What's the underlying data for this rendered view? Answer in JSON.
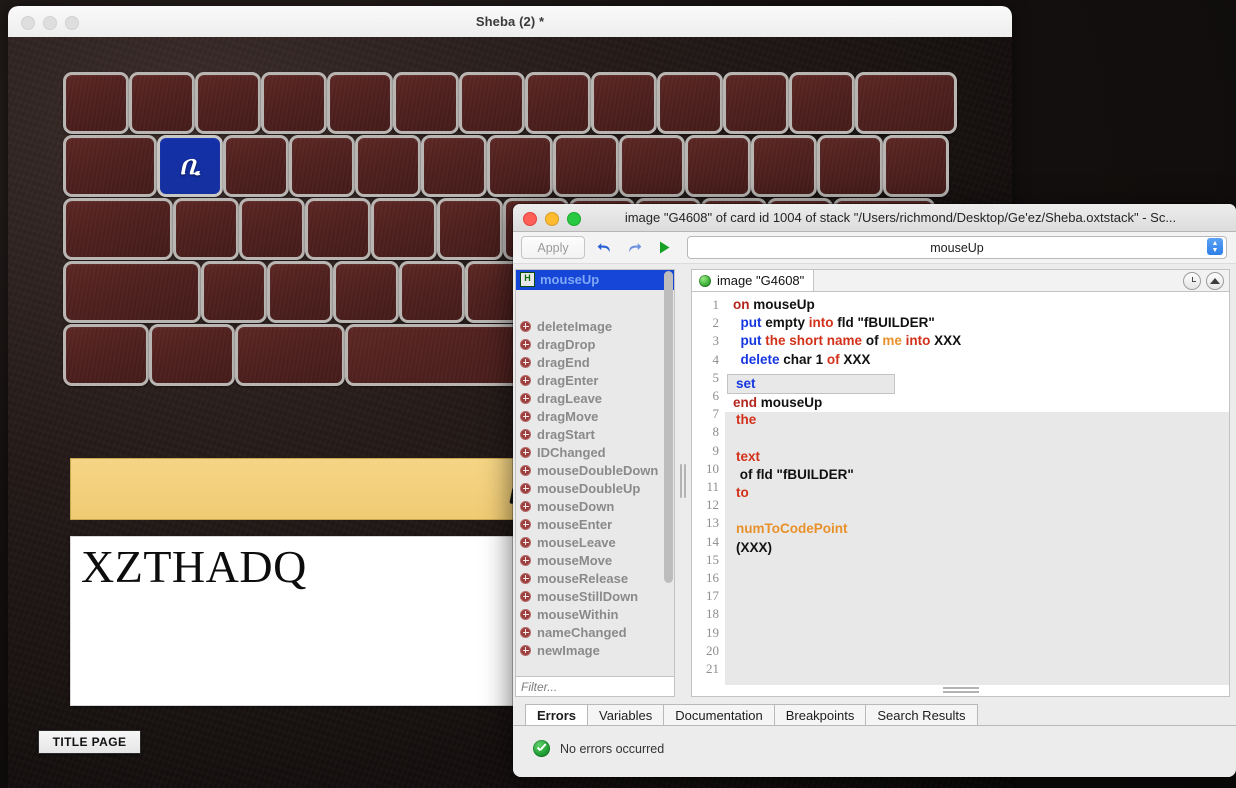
{
  "stack_window": {
    "title": "Sheba (2) *",
    "traffic_lights": [
      "close",
      "minimize",
      "zoom"
    ],
    "keyboard": {
      "selected_key_glyph": "ቢ",
      "rows": [
        {
          "count": 13,
          "widths": [
            60,
            60,
            60,
            60,
            60,
            60,
            60,
            60,
            60,
            60,
            60,
            60,
            96
          ]
        },
        {
          "count": 13,
          "widths": [
            88,
            60,
            60,
            60,
            60,
            60,
            60,
            60,
            60,
            60,
            60,
            60,
            60
          ]
        },
        {
          "count": 12,
          "widths": [
            104,
            60,
            60,
            60,
            60,
            60,
            60,
            60,
            60,
            60,
            60,
            96
          ]
        },
        {
          "count": 11,
          "widths": [
            132,
            60,
            60,
            60,
            60,
            60,
            60,
            60,
            60,
            60,
            112
          ]
        },
        {
          "count": 5,
          "widths": [
            80,
            80,
            104,
            260,
            120
          ]
        }
      ]
    },
    "display_bar": {
      "glyph": "ቢ"
    },
    "builder_field": {
      "name": "fBUILDER",
      "text": "XZTHADQ"
    },
    "title_page_button": "TITLE PAGE"
  },
  "script_editor": {
    "title": "image \"G4608\" of card id 1004 of stack \"/Users/richmond/Desktop/Ge'ez/Sheba.oxtstack\" - Sc...",
    "toolbar": {
      "apply_label": "Apply",
      "undo_icon": "undo-arrow-icon",
      "redo_icon": "redo-arrow-icon",
      "run_icon": "run-play-icon",
      "handler_select_value": "mouseUp"
    },
    "handler_list": {
      "selected": {
        "badge": "H",
        "label": "mouseUp"
      },
      "items": [
        "deleteImage",
        "dragDrop",
        "dragEnd",
        "dragEnter",
        "dragLeave",
        "dragMove",
        "dragStart",
        "IDChanged",
        "mouseDoubleDown",
        "mouseDoubleUp",
        "mouseDown",
        "mouseEnter",
        "mouseLeave",
        "mouseMove",
        "mouseRelease",
        "mouseStillDown",
        "mouseWithin",
        "nameChanged",
        "newImage"
      ],
      "filter_placeholder": "Filter..."
    },
    "editor": {
      "tab_label": "image \"G4608\"",
      "recent_icon": "clock-icon",
      "collapse_icon": "chevron-up-icon",
      "line_numbers": [
        1,
        2,
        3,
        4,
        5,
        6,
        7,
        8,
        9,
        10,
        11,
        12,
        13,
        14,
        15,
        16,
        17,
        18,
        19,
        20,
        21
      ],
      "code_lines": [
        [
          [
            "on ",
            "kw"
          ],
          [
            "mouseUp",
            "plain"
          ]
        ],
        [
          [
            "  ",
            "plain"
          ],
          [
            "put",
            "kwb"
          ],
          [
            " empty ",
            "plain"
          ],
          [
            "into",
            "kwr"
          ],
          [
            " fld \"fBUILDER\"",
            "plain"
          ]
        ],
        [
          [
            "  ",
            "plain"
          ],
          [
            "put",
            "kwb"
          ],
          [
            " ",
            "plain"
          ],
          [
            "the",
            "kwr"
          ],
          [
            " ",
            "plain"
          ],
          [
            "short name",
            "kwr"
          ],
          [
            " of ",
            "plain"
          ],
          [
            "me",
            "kwo"
          ],
          [
            " ",
            "plain"
          ],
          [
            "into",
            "kwr"
          ],
          [
            " XXX",
            "plain"
          ]
        ],
        [
          [
            "  ",
            "plain"
          ],
          [
            "delete",
            "kwb"
          ],
          [
            " char ",
            "plain"
          ],
          [
            "1",
            "plain"
          ],
          [
            " ",
            "plain"
          ],
          [
            "of",
            "kwr"
          ],
          [
            " XXX",
            "plain"
          ]
        ],
        [
          [
            "  ",
            "plain"
          ],
          [
            "set",
            "kwb"
          ],
          [
            " ",
            "plain"
          ],
          [
            "the",
            "kwr"
          ],
          [
            " ",
            "plain"
          ],
          [
            "text",
            "kwr"
          ],
          [
            " of fld \"fBUILDER\" ",
            "plain"
          ],
          [
            "to",
            "kwr"
          ],
          [
            " ",
            "plain"
          ],
          [
            "numToCodePoint",
            "kwo"
          ],
          [
            "(XXX)",
            "plain"
          ]
        ],
        [
          [
            "end ",
            "kw"
          ],
          [
            "mouseUp",
            "plain"
          ]
        ]
      ]
    },
    "bottom": {
      "tabs": [
        "Errors",
        "Variables",
        "Documentation",
        "Breakpoints",
        "Search Results"
      ],
      "active_tab": "Errors",
      "status_icon": "check-circle-icon",
      "status_text": "No errors occurred"
    }
  }
}
